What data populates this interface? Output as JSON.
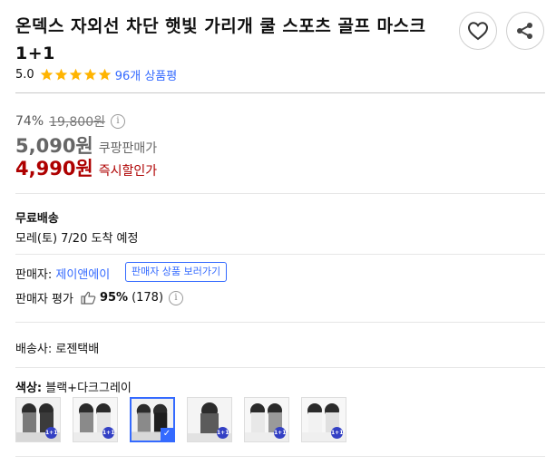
{
  "product": {
    "title": "온덱스 자외선 차단 햇빛 가리개 쿨 스포츠 골프 마스크 1+1"
  },
  "actions": {
    "like_icon": "heart-icon",
    "share_icon": "share-icon"
  },
  "rating": {
    "score": "5.0",
    "stars": 5,
    "review_count": "96개 상품평"
  },
  "price": {
    "discount_rate": "74%",
    "original": "19,800원",
    "coupang_price": "5,090원",
    "coupang_label": "쿠팡판매가",
    "instant_price": "4,990원",
    "instant_label": "즉시할인가",
    "colors": {
      "coupang": "#666666",
      "instant": "#ae0000"
    }
  },
  "shipping": {
    "label": "무료배송",
    "eta": "모레(토) 7/20 도착 예정"
  },
  "seller": {
    "label": "판매자:",
    "name": "제이앤에이",
    "button": "판매자 상품 보러가기",
    "rating_label": "판매자 평가",
    "rating_percent": "95%",
    "rating_count": "(178)"
  },
  "carrier": {
    "text": "배송사: 로젠택배"
  },
  "option": {
    "label": "색상:",
    "value": "블랙+다크그레이",
    "thumbnails": [
      {
        "selected": false,
        "badge": "1+1"
      },
      {
        "selected": false,
        "badge": "1+1"
      },
      {
        "selected": true,
        "badge": ""
      },
      {
        "selected": false,
        "badge": "1+1"
      },
      {
        "selected": false,
        "badge": "1+1"
      },
      {
        "selected": false,
        "badge": "1+1"
      }
    ]
  }
}
